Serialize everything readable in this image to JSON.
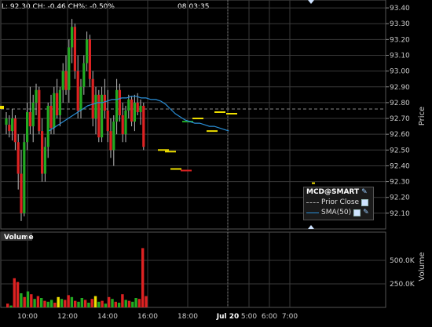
{
  "header": {
    "quote_text": "L: 92.30  CH: -0.46  CH%: -0.50%",
    "time_text": "08:03:35"
  },
  "legend": {
    "title": "MCD@SMART",
    "items": [
      {
        "label": "Prior Close",
        "color": "#aaaaaa",
        "style": "dashed"
      },
      {
        "label": "SMA(50)",
        "color": "#2a8fd8",
        "style": "solid"
      }
    ]
  },
  "colors": {
    "up": "#22aa22",
    "down": "#dd2222",
    "yellow": "#f0e000",
    "sma": "#2a8fd8",
    "grid": "#3a3a3a",
    "prior_close": "#888888"
  },
  "chart_data": [
    {
      "type": "candlestick",
      "title": "",
      "ylabel": "Price",
      "ylim": [
        92.0,
        93.45
      ],
      "y_ticks": [
        "93.40",
        "93.30",
        "93.20",
        "93.10",
        "93.00",
        "92.90",
        "92.80",
        "92.70",
        "92.60",
        "92.50",
        "92.40",
        "92.30",
        "92.20",
        "92.10"
      ],
      "x_ticks": [
        "10:00",
        "12:00",
        "14:00",
        "16:00",
        "18:00",
        "Jul 20",
        "5:00",
        "6:00",
        "7:00"
      ],
      "prior_close": 92.76,
      "bars": [
        [
          92.7,
          92.74,
          92.6,
          92.66,
          "up"
        ],
        [
          92.66,
          92.72,
          92.58,
          92.62,
          "down"
        ],
        [
          92.62,
          92.76,
          92.56,
          92.7,
          "up"
        ],
        [
          92.7,
          92.72,
          92.5,
          92.55,
          "down"
        ],
        [
          92.55,
          92.6,
          92.25,
          92.35,
          "down"
        ],
        [
          92.35,
          92.5,
          92.05,
          92.1,
          "down"
        ],
        [
          92.1,
          92.6,
          92.08,
          92.55,
          "up"
        ],
        [
          92.55,
          92.8,
          92.5,
          92.74,
          "up"
        ],
        [
          92.74,
          92.9,
          92.6,
          92.65,
          "down"
        ],
        [
          92.65,
          92.85,
          92.55,
          92.8,
          "up"
        ],
        [
          92.8,
          92.92,
          92.72,
          92.88,
          "up"
        ],
        [
          92.88,
          92.9,
          92.6,
          92.62,
          "down"
        ],
        [
          92.62,
          92.7,
          92.3,
          92.35,
          "down"
        ],
        [
          92.35,
          92.58,
          92.3,
          92.52,
          "up"
        ],
        [
          92.52,
          92.8,
          92.45,
          92.78,
          "up"
        ],
        [
          92.78,
          92.85,
          92.6,
          92.64,
          "down"
        ],
        [
          92.64,
          92.9,
          92.6,
          92.86,
          "up"
        ],
        [
          92.86,
          92.95,
          92.7,
          92.72,
          "down"
        ],
        [
          92.72,
          92.9,
          92.65,
          92.88,
          "up"
        ],
        [
          92.88,
          93.05,
          92.8,
          93.0,
          "up"
        ],
        [
          93.0,
          93.1,
          92.85,
          92.88,
          "down"
        ],
        [
          92.88,
          93.2,
          92.8,
          93.15,
          "up"
        ],
        [
          93.15,
          93.33,
          93.05,
          93.28,
          "up"
        ],
        [
          93.28,
          93.3,
          92.95,
          93.0,
          "down"
        ],
        [
          93.0,
          93.1,
          92.7,
          92.75,
          "down"
        ],
        [
          92.75,
          92.95,
          92.7,
          92.9,
          "up"
        ],
        [
          92.9,
          93.1,
          92.85,
          93.05,
          "up"
        ],
        [
          93.05,
          93.25,
          93.0,
          93.2,
          "up"
        ],
        [
          93.2,
          93.23,
          92.9,
          92.95,
          "down"
        ],
        [
          92.95,
          93.0,
          92.65,
          92.7,
          "down"
        ],
        [
          92.7,
          92.9,
          92.6,
          92.85,
          "up"
        ],
        [
          92.85,
          92.88,
          92.55,
          92.58,
          "down"
        ],
        [
          92.58,
          92.9,
          92.55,
          92.85,
          "up"
        ],
        [
          92.85,
          92.95,
          92.7,
          92.75,
          "down"
        ],
        [
          92.75,
          92.88,
          92.55,
          92.62,
          "down"
        ],
        [
          92.62,
          92.7,
          92.45,
          92.5,
          "down"
        ],
        [
          92.5,
          92.72,
          92.4,
          92.68,
          "up"
        ],
        [
          92.68,
          92.95,
          92.6,
          92.88,
          "up"
        ],
        [
          92.88,
          92.92,
          92.68,
          92.72,
          "down"
        ],
        [
          92.72,
          92.8,
          92.55,
          92.6,
          "down"
        ],
        [
          92.6,
          92.78,
          92.55,
          92.75,
          "up"
        ],
        [
          92.75,
          92.85,
          92.7,
          92.82,
          "up"
        ],
        [
          92.82,
          92.84,
          92.65,
          92.68,
          "down"
        ],
        [
          92.68,
          92.85,
          92.62,
          92.8,
          "up"
        ],
        [
          92.8,
          92.86,
          92.72,
          92.74,
          "down"
        ],
        [
          92.74,
          92.82,
          92.66,
          92.78,
          "up"
        ],
        [
          92.78,
          92.8,
          92.5,
          92.52,
          "down"
        ]
      ],
      "after_hours": [
        [
          92.5,
          "yellow"
        ],
        [
          92.49,
          "yellow"
        ],
        [
          92.38,
          "yellow"
        ],
        [
          92.37,
          "down"
        ],
        [
          92.68,
          "up"
        ],
        [
          92.7,
          "yellow"
        ],
        [
          92.62,
          "yellow"
        ],
        [
          92.74,
          "yellow"
        ],
        [
          92.73,
          "yellow"
        ],
        [
          92.29,
          "yellow"
        ]
      ],
      "sma50": [
        92.62,
        92.64,
        92.66,
        92.68,
        92.7,
        92.72,
        92.74,
        92.76,
        92.78,
        92.79,
        92.8,
        92.8,
        92.81,
        92.82,
        92.82,
        92.83,
        92.83,
        92.84,
        92.84,
        92.83,
        92.83,
        92.82,
        92.82,
        92.81,
        92.79,
        92.76,
        92.73,
        92.71,
        92.69,
        92.68,
        92.67,
        92.67,
        92.66,
        92.65,
        92.65,
        92.64,
        92.63,
        92.62
      ]
    },
    {
      "type": "bar",
      "title": "Volume",
      "ylabel": "Volume",
      "y_ticks": [
        "500.0K",
        "250.0K"
      ],
      "ylim": [
        0,
        700000
      ],
      "values": [
        [
          40000,
          "down"
        ],
        [
          20000,
          "up"
        ],
        [
          310000,
          "down"
        ],
        [
          270000,
          "down"
        ],
        [
          150000,
          "up"
        ],
        [
          110000,
          "down"
        ],
        [
          170000,
          "up"
        ],
        [
          140000,
          "down"
        ],
        [
          90000,
          "up"
        ],
        [
          120000,
          "down"
        ],
        [
          100000,
          "up"
        ],
        [
          70000,
          "down"
        ],
        [
          60000,
          "up"
        ],
        [
          80000,
          "up"
        ],
        [
          50000,
          "down"
        ],
        [
          110000,
          "yellow"
        ],
        [
          90000,
          "up"
        ],
        [
          80000,
          "down"
        ],
        [
          130000,
          "down"
        ],
        [
          110000,
          "up"
        ],
        [
          70000,
          "down"
        ],
        [
          60000,
          "up"
        ],
        [
          100000,
          "up"
        ],
        [
          80000,
          "down"
        ],
        [
          50000,
          "up"
        ],
        [
          90000,
          "down"
        ],
        [
          120000,
          "yellow"
        ],
        [
          60000,
          "up"
        ],
        [
          70000,
          "down"
        ],
        [
          40000,
          "up"
        ],
        [
          110000,
          "down"
        ],
        [
          90000,
          "up"
        ],
        [
          60000,
          "down"
        ],
        [
          50000,
          "up"
        ],
        [
          140000,
          "down"
        ],
        [
          80000,
          "up"
        ],
        [
          70000,
          "down"
        ],
        [
          60000,
          "up"
        ],
        [
          100000,
          "up"
        ],
        [
          90000,
          "down"
        ],
        [
          630000,
          "down"
        ],
        [
          120000,
          "down"
        ]
      ]
    }
  ]
}
